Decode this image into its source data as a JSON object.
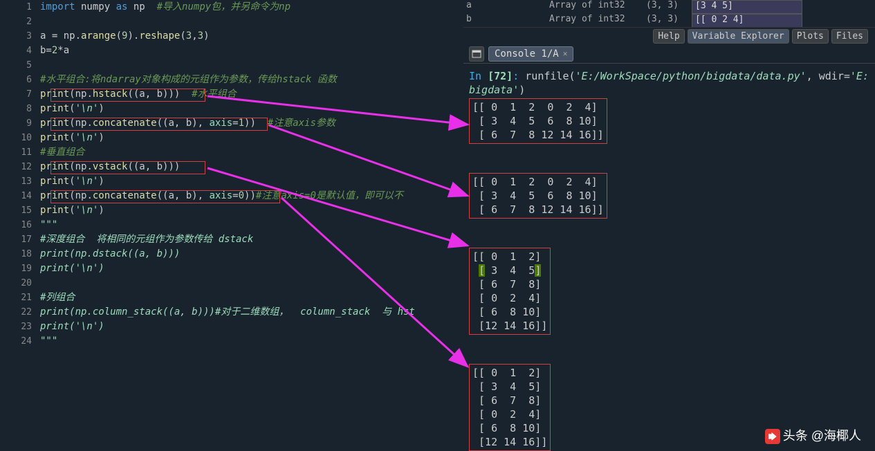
{
  "editor": {
    "lines": [
      {
        "n": "1",
        "html": "<span class='kw'>import</span> numpy <span class='kw'>as</span> np  <span class='cmt'>#导入numpy包，并另命令为np</span>"
      },
      {
        "n": "2",
        "html": ""
      },
      {
        "n": "3",
        "html": "a = np.<span class='fn'>arange</span>(<span class='num'>9</span>).<span class='fn'>reshape</span>(<span class='num'>3</span>,<span class='num'>3</span>)"
      },
      {
        "n": "4",
        "html": "b=<span class='num'>2</span>*a"
      },
      {
        "n": "5",
        "html": ""
      },
      {
        "n": "6",
        "html": "<span class='cmt'>#水平组合:将ndarray对象构成的元组作为参数，传给hstack 函数</span>"
      },
      {
        "n": "7",
        "html": "<span class='fn'>print</span>(np.<span class='fn'>hstack</span>((a, b)))  <span class='cmt'>#水平组合</span>"
      },
      {
        "n": "8",
        "html": "<span class='fn'>print</span>(<span class='str'>'\\n'</span>)"
      },
      {
        "n": "9",
        "html": "<span class='fn'>print</span>(np.<span class='fn'>concatenate</span>((a, b), <span class='var'>axis</span>=<span class='num'>1</span>))  <span class='cmt'>#注意axis参数</span>"
      },
      {
        "n": "10",
        "html": "<span class='fn'>print</span>(<span class='str'>'\\n'</span>)"
      },
      {
        "n": "11",
        "html": "<span class='cmt'>#垂直组合</span>"
      },
      {
        "n": "12",
        "html": "<span class='fn'>print</span>(np.<span class='fn'>vstack</span>((a, b)))"
      },
      {
        "n": "13",
        "html": "<span class='fn'>print</span>(<span class='str'>'\\n'</span>)"
      },
      {
        "n": "14",
        "html": "<span class='fn'>print</span>(np.<span class='fn'>concatenate</span>((a, b), <span class='var'>axis</span>=<span class='num'>0</span>))<span class='cmt'>#注意axis=0是默认值，即可以不</span>"
      },
      {
        "n": "15",
        "html": "<span class='fn'>print</span>(<span class='str'>'\\n'</span>)"
      },
      {
        "n": "16",
        "html": "<span class='str'>\"\"\"</span>"
      },
      {
        "n": "17",
        "html": "<span class='str'>#深度组合  将相同的元组作为参数传给 dstack</span>"
      },
      {
        "n": "18",
        "html": "<span class='str'>print(np.dstack((a, b)))</span>"
      },
      {
        "n": "19",
        "html": "<span class='str'>print('\\n')</span>"
      },
      {
        "n": "20",
        "html": ""
      },
      {
        "n": "21",
        "html": "<span class='str'>#列组合</span>"
      },
      {
        "n": "22",
        "html": "<span class='str'>print(np.column_stack((a, b)))#对于二维数组，  column_stack  与 hst</span>"
      },
      {
        "n": "23",
        "html": "<span class='str'>print('\\n')</span>"
      },
      {
        "n": "24",
        "html": "<span class='str'>\"\"\"</span>"
      }
    ]
  },
  "varExplorer": {
    "rows": [
      {
        "name": "a",
        "type": "Array of int32",
        "shape": "(3, 3)",
        "val": "[3 4 5]"
      },
      {
        "name": "b",
        "type": "Array of int32",
        "shape": "(3, 3)",
        "val": "[[ 0  2  4]"
      }
    ]
  },
  "panelTabs": {
    "help": "Help",
    "varexp": "Variable Explorer",
    "plots": "Plots",
    "files": "Files"
  },
  "consoleTab": {
    "label": "Console 1/A"
  },
  "console": {
    "prompt_in": "In ",
    "prompt_num": "[72]",
    "prompt_colon": ": ",
    "runcmd": "runfile",
    "arg1": "'E:/WorkSpace/python/bigdata/data.py'",
    "wdir": ", wdir=",
    "arg2": "'E:\nbigdata'",
    "close": ")",
    "out1": "[[ 0  1  2  0  2  4]\n [ 3  4  5  6  8 10]\n [ 6  7  8 12 14 16]]",
    "out2": "[[ 0  1  2  0  2  4]\n [ 3  4  5  6  8 10]\n [ 6  7  8 12 14 16]]",
    "out3": "[[ 0  1  2]\n [ 3  4  5]\n [ 6  7  8]\n [ 0  2  4]\n [ 6  8 10]\n [12 14 16]]",
    "out3_hl_open": "[",
    "out3_hl_close": "]",
    "out4": "[[ 0  1  2]\n [ 3  4  5]\n [ 6  7  8]\n [ 0  2  4]\n [ 6  8 10]\n [12 14 16]]"
  },
  "watermark": "头条 @海椰人"
}
